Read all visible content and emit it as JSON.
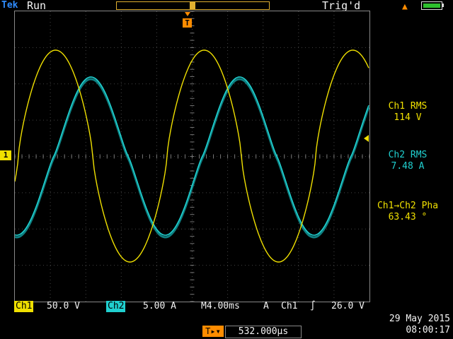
{
  "top_bar": {
    "brand": "Tek",
    "run_state": "Run",
    "trigger_status": "Trig'd",
    "warning_icon": "warning-triangle-icon",
    "battery_icon": "battery-icon"
  },
  "markers": {
    "trigger_position": "T",
    "channel1_ground": "1"
  },
  "measurements": {
    "ch1_rms_label": "Ch1 RMS",
    "ch1_rms_value": "114 V",
    "ch2_rms_label": "Ch2 RMS",
    "ch2_rms_value": "7.48 A",
    "phase_label": "Ch1→Ch2 Pha",
    "phase_value": "63.43 °"
  },
  "bottom_bar": {
    "ch1_label": "Ch1",
    "ch1_scale": "50.0 V",
    "ch2_label": "Ch2",
    "ch2_scale": "5.00 A",
    "timebase": "M4.00ms",
    "trigger_mode": "A",
    "trigger_channel": "Ch1",
    "trigger_edge": "∫",
    "trigger_level": "26.0 V"
  },
  "delay": {
    "icon": "T▸▾",
    "value": "532.000µs"
  },
  "datetime": {
    "date": "29 May 2015",
    "time": "08:00:17"
  },
  "colors": {
    "ch1": "#f0e000",
    "ch2": "#20d0d0",
    "accent": "#ff8c00"
  }
}
